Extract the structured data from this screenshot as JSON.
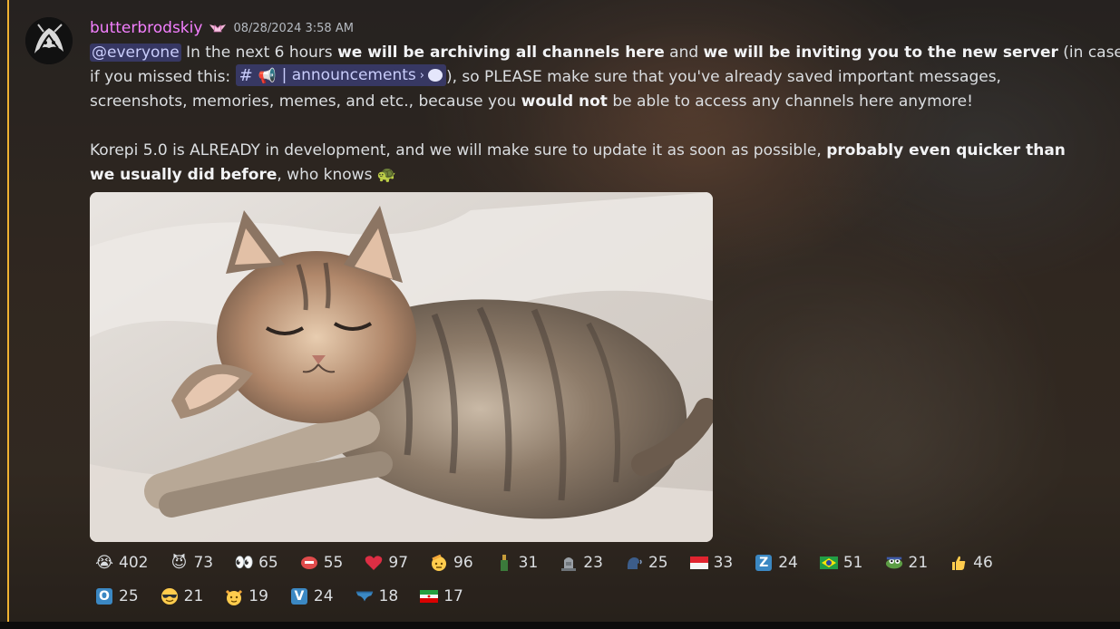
{
  "message": {
    "author": "butterbrodskiy",
    "role_icon": "crown-wings-icon",
    "timestamp": "08/28/2024 3:58 AM",
    "mention": "@everyone",
    "channel_mention": {
      "icon": "megaphone-icon",
      "name": "| announcements",
      "trail_icon": "speech-bubble-icon"
    },
    "para1": {
      "t1": " In the next 6 hours ",
      "b1": "we will be archiving all channels here",
      "t2": " and ",
      "b2": "we will be inviting you to the new server",
      "t3": " (in case",
      "t4": "if you missed this: ",
      "t5": "), so PLEASE make sure that you've already saved important messages,",
      "t6": "screenshots, memories, memes, and etc., because you ",
      "b3": "would not",
      "t7": " be able to access any channels here anymore!"
    },
    "para2": {
      "t1": "Korepi 5.0 is ALREADY in development, and we will make sure to update it as soon as possible, ",
      "b1": "probably even quicker than",
      "b2": "we usually did before",
      "t2": ", who knows ",
      "emoji": "turtle-emoji"
    },
    "attachment": {
      "description": "sleeping-kitten-image"
    }
  },
  "reactions": [
    [
      {
        "emoji": "crying-face",
        "glyph": "😭",
        "count": "402"
      },
      {
        "emoji": "smiling-imp",
        "glyph": "😈",
        "count": "73"
      },
      {
        "emoji": "eyes",
        "glyph": "👀",
        "count": "65"
      },
      {
        "emoji": "biting-lip-face",
        "glyph": "🫦",
        "count": "55"
      },
      {
        "emoji": "red-heart",
        "glyph": "❤",
        "count": "97"
      },
      {
        "emoji": "saluting-face",
        "glyph": "🫡",
        "count": "96"
      },
      {
        "emoji": "bottle",
        "glyph": "🍾",
        "count": "31"
      },
      {
        "emoji": "tomb",
        "glyph": "🪦",
        "count": "23"
      },
      {
        "emoji": "speaking-head",
        "glyph": "🗣",
        "count": "25"
      },
      {
        "emoji": "flag-indonesia",
        "glyph": "",
        "count": "33"
      },
      {
        "emoji": "regional-z",
        "glyph": "Z",
        "count": "24"
      },
      {
        "emoji": "flag-brazil",
        "glyph": "",
        "count": "51"
      },
      {
        "emoji": "pepe-custom",
        "glyph": "",
        "count": "21"
      },
      {
        "emoji": "thumbs-up",
        "glyph": "👍",
        "count": "46"
      }
    ],
    [
      {
        "emoji": "regional-o",
        "glyph": "O",
        "count": "25"
      },
      {
        "emoji": "sunglasses-face",
        "glyph": "😎",
        "count": "21"
      },
      {
        "emoji": "cat-face",
        "glyph": "😺",
        "count": "19"
      },
      {
        "emoji": "regional-v",
        "glyph": "V",
        "count": "24"
      },
      {
        "emoji": "briefs",
        "glyph": "🩲",
        "count": "18"
      },
      {
        "emoji": "flag-iran",
        "glyph": "",
        "count": "17"
      }
    ]
  ],
  "colors": {
    "username": "#f47fff",
    "mention_bar": "#f0b232",
    "mention_bg": "#5865f2"
  }
}
